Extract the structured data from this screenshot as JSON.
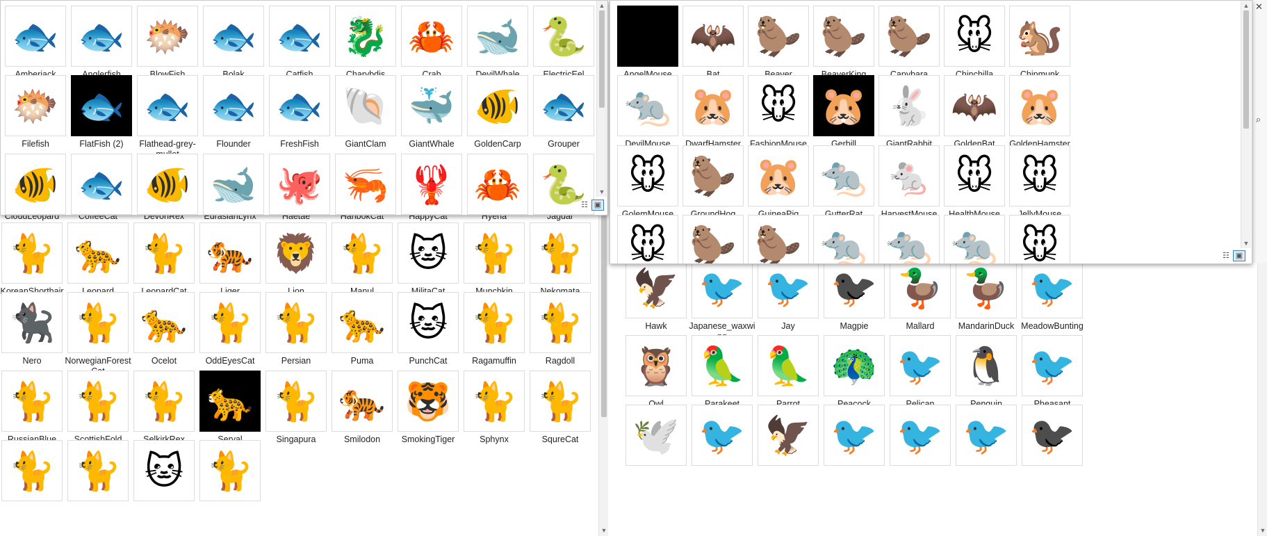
{
  "cats_window": {
    "partial_top_labels": [
      "CloudLeopard",
      "CoffeeCat",
      "DevonRex",
      "EurasianLynx",
      "Haetae",
      "HanbokCat",
      "HappyCat",
      "Hyena",
      "Jaguar"
    ],
    "rows": [
      [
        {
          "label": "KoreanShorthair",
          "glyph": "🐈"
        },
        {
          "label": "Leopard",
          "glyph": "🐆"
        },
        {
          "label": "LeopardCat",
          "glyph": "🐈"
        },
        {
          "label": "Liger",
          "glyph": "🐅"
        },
        {
          "label": "Lion",
          "glyph": "🦁"
        },
        {
          "label": "Manul",
          "glyph": "🐈"
        },
        {
          "label": "MilitaCat",
          "glyph": "🐱"
        },
        {
          "label": "Munchkin",
          "glyph": "🐈"
        },
        {
          "label": "Nekomata",
          "glyph": "🐈"
        }
      ],
      [
        {
          "label": "Nero",
          "glyph": "🐈‍⬛"
        },
        {
          "label": "NorwegianForestCat",
          "glyph": "🐈"
        },
        {
          "label": "Ocelot",
          "glyph": "🐆"
        },
        {
          "label": "OddEyesCat",
          "glyph": "🐈"
        },
        {
          "label": "Persian",
          "glyph": "🐈"
        },
        {
          "label": "Puma",
          "glyph": "🐆"
        },
        {
          "label": "PunchCat",
          "glyph": "🐱"
        },
        {
          "label": "Ragamuffin",
          "glyph": "🐈"
        },
        {
          "label": "Ragdoll",
          "glyph": "🐈"
        }
      ],
      [
        {
          "label": "RussianBlue",
          "glyph": "🐈"
        },
        {
          "label": "ScottishFold",
          "glyph": "🐈"
        },
        {
          "label": "SelkirkRex",
          "glyph": "🐈"
        },
        {
          "label": "Serval",
          "glyph": "🐆",
          "dark": true
        },
        {
          "label": "Singapura",
          "glyph": "🐈"
        },
        {
          "label": "Smilodon",
          "glyph": "🐅"
        },
        {
          "label": "SmokingTiger",
          "glyph": "🐯"
        },
        {
          "label": "Sphynx",
          "glyph": "🐈"
        },
        {
          "label": "SqureCat",
          "glyph": "🐈"
        }
      ],
      [
        {
          "label": "",
          "glyph": "🐈"
        },
        {
          "label": "",
          "glyph": "🐈"
        },
        {
          "label": "",
          "glyph": "🐱"
        },
        {
          "label": "",
          "glyph": "🐈"
        }
      ]
    ]
  },
  "birds_window": {
    "rows": [
      [
        {
          "label": "Hawk",
          "glyph": "🦅"
        },
        {
          "label": "Japanese_waxwing",
          "glyph": "🐦"
        },
        {
          "label": "Jay",
          "glyph": "🐦"
        },
        {
          "label": "Magpie",
          "glyph": "🐦‍⬛"
        },
        {
          "label": "Mallard",
          "glyph": "🦆"
        },
        {
          "label": "MandarinDuck",
          "glyph": "🦆"
        },
        {
          "label": "MeadowBunting",
          "glyph": "🐦"
        }
      ],
      [
        {
          "label": "Owl",
          "glyph": "🦉"
        },
        {
          "label": "Parakeet",
          "glyph": "🦜"
        },
        {
          "label": "Parrot",
          "glyph": "🦜"
        },
        {
          "label": "Peacock",
          "glyph": "🦚"
        },
        {
          "label": "Pelican",
          "glyph": "🐦"
        },
        {
          "label": "Penquin",
          "glyph": "🐧"
        },
        {
          "label": "Pheasant",
          "glyph": "🐦"
        }
      ],
      [
        {
          "label": "",
          "glyph": "🕊️"
        },
        {
          "label": "",
          "glyph": "🐦"
        },
        {
          "label": "",
          "glyph": "🦅"
        },
        {
          "label": "",
          "glyph": "🐦"
        },
        {
          "label": "",
          "glyph": "🐦"
        },
        {
          "label": "",
          "glyph": "🐦"
        },
        {
          "label": "",
          "glyph": "🐦‍⬛"
        }
      ]
    ]
  },
  "fish_window": {
    "rows": [
      [
        {
          "label": "Amberjack",
          "glyph": "🐟"
        },
        {
          "label": "Anglerfish",
          "glyph": "🐟"
        },
        {
          "label": "BlowFish",
          "glyph": "🐡"
        },
        {
          "label": "Bolak",
          "glyph": "🐟"
        },
        {
          "label": "Catfish",
          "glyph": "🐟"
        },
        {
          "label": "Charybdis",
          "glyph": "🐉"
        },
        {
          "label": "Crab",
          "glyph": "🦀"
        },
        {
          "label": "DevilWhale",
          "glyph": "🐋"
        },
        {
          "label": "ElectricEel",
          "glyph": "🐍"
        }
      ],
      [
        {
          "label": "Filefish",
          "glyph": "🐡"
        },
        {
          "label": "FlatFish (2)",
          "glyph": "🐟",
          "dark": true
        },
        {
          "label": "Flathead-grey-mullet",
          "glyph": "🐟"
        },
        {
          "label": "Flounder",
          "glyph": "🐟"
        },
        {
          "label": "FreshFish",
          "glyph": "🐟"
        },
        {
          "label": "GiantClam",
          "glyph": "🐚"
        },
        {
          "label": "GiantWhale",
          "glyph": "🐳"
        },
        {
          "label": "GoldenCarp",
          "glyph": "🐠"
        },
        {
          "label": "Grouper",
          "glyph": "🐟"
        }
      ],
      [
        {
          "label": "",
          "glyph": "🐠"
        },
        {
          "label": "",
          "glyph": "🐟"
        },
        {
          "label": "",
          "glyph": "🐠"
        },
        {
          "label": "",
          "glyph": "🐋"
        },
        {
          "label": "",
          "glyph": "🐙"
        },
        {
          "label": "",
          "glyph": "🦐"
        },
        {
          "label": "",
          "glyph": "🦞"
        },
        {
          "label": "",
          "glyph": "🦀"
        },
        {
          "label": "",
          "glyph": "🐍"
        }
      ]
    ]
  },
  "rodents_window": {
    "rows": [
      [
        {
          "label": "AngelMouse",
          "glyph": "🐭",
          "dark": true
        },
        {
          "label": "Bat",
          "glyph": "🦇"
        },
        {
          "label": "Beaver",
          "glyph": "🦫"
        },
        {
          "label": "BeaverKing",
          "glyph": "🦫"
        },
        {
          "label": "Capybara",
          "glyph": "🦫"
        },
        {
          "label": "Chinchilla",
          "glyph": "🐭"
        },
        {
          "label": "Chipmunk",
          "glyph": "🐿️"
        }
      ],
      [
        {
          "label": "DevilMouse",
          "glyph": "🐀"
        },
        {
          "label": "DwarfHamster",
          "glyph": "🐹"
        },
        {
          "label": "FashionMouse",
          "glyph": "🐭"
        },
        {
          "label": "Gerbill",
          "glyph": "🐹",
          "dark": true
        },
        {
          "label": "GiantRabbit",
          "glyph": "🐇"
        },
        {
          "label": "GoldenBat",
          "glyph": "🦇"
        },
        {
          "label": "GoldenHamster",
          "glyph": "🐹"
        }
      ],
      [
        {
          "label": "GolemMouse",
          "glyph": "🐭"
        },
        {
          "label": "GroundHog",
          "glyph": "🦫"
        },
        {
          "label": "GuineaPig",
          "glyph": "🐹"
        },
        {
          "label": "GutterRat",
          "glyph": "🐀"
        },
        {
          "label": "HarvestMouse",
          "glyph": "🐁"
        },
        {
          "label": "HealthMouse",
          "glyph": "🐭"
        },
        {
          "label": "JellyMouse",
          "glyph": "🐭"
        }
      ],
      [
        {
          "label": "",
          "glyph": "🐭"
        },
        {
          "label": "",
          "glyph": "🦫"
        },
        {
          "label": "",
          "glyph": "🦫"
        },
        {
          "label": "",
          "glyph": "🐀"
        },
        {
          "label": "",
          "glyph": "🐀"
        },
        {
          "label": "",
          "glyph": "🐀"
        },
        {
          "label": "",
          "glyph": "🐭"
        }
      ]
    ]
  },
  "view_toggle": {
    "details_icon": "☷",
    "icons_icon": "▣"
  },
  "edge_glyph": "⌕",
  "close_glyph": "✕"
}
